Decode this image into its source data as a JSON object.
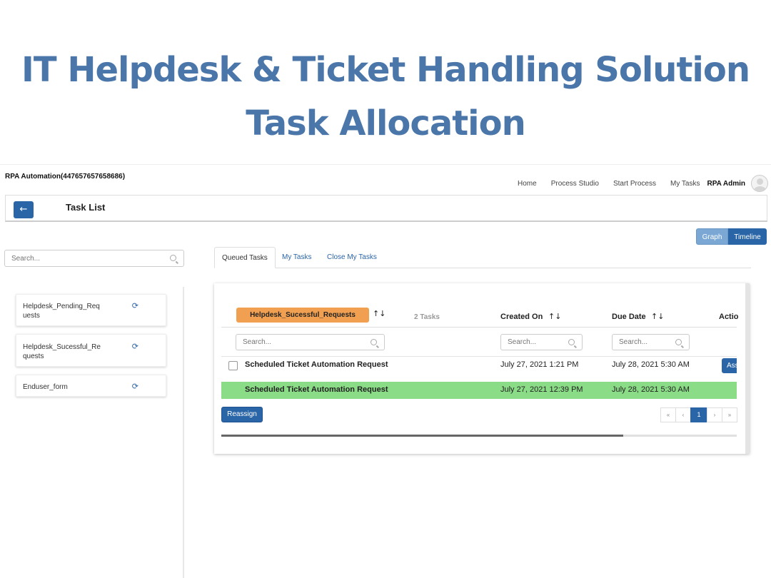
{
  "slide": {
    "title_line1": "IT Helpdesk & Ticket Handling Solution",
    "title_line2": "Task Allocation"
  },
  "topbar": {
    "brand": "RPA Automation(447657657658686)",
    "nav": [
      "Home",
      "Process Studio",
      "Start Process",
      "My Tasks"
    ],
    "user": "RPA Admin"
  },
  "page": {
    "title": "Task List",
    "back_icon": "arrow-left-icon"
  },
  "view_toggle": {
    "graph": "Graph",
    "timeline": "Timeline",
    "active": "Timeline"
  },
  "sidebar": {
    "search_placeholder": "Search...",
    "processes": [
      {
        "label": "Helpdesk_Pending_Req uests",
        "icon": "refresh-icon"
      },
      {
        "label": "Helpdesk_Sucessful_Re quests",
        "icon": "refresh-icon"
      },
      {
        "label": "Enduser_form",
        "icon": "refresh-icon"
      }
    ]
  },
  "tabs": [
    "Queued Tasks",
    "My Tasks",
    "Close My Tasks"
  ],
  "active_tab": "Queued Tasks",
  "task_table": {
    "process_name": "Helpdesk_Sucessful_Requests",
    "task_count": "2 Tasks",
    "columns": {
      "created": "Created On",
      "due": "Due Date",
      "action": "Actio"
    },
    "search_placeholder": "Search...",
    "rows": [
      {
        "name": "Scheduled Ticket Automation Request",
        "created": "July 27, 2021 1:21 PM",
        "due": "July 28, 2021 5:30 AM",
        "action": "Ass",
        "highlighted": false
      },
      {
        "name": "Scheduled Ticket Automation Request",
        "created": "July 27, 2021 12:39 PM",
        "due": "July 28, 2021 5:30 AM",
        "action": "",
        "highlighted": true
      }
    ],
    "reassign": "Reassign",
    "pagination": {
      "first": "«",
      "prev": "‹",
      "current": "1",
      "next": "›",
      "last": "»"
    },
    "scroll_fraction": 0.78
  },
  "colors": {
    "title_blue": "#4a76aa",
    "primary": "#2a65a8",
    "pill_orange": "#f0a050",
    "row_green": "#8bdc87"
  }
}
